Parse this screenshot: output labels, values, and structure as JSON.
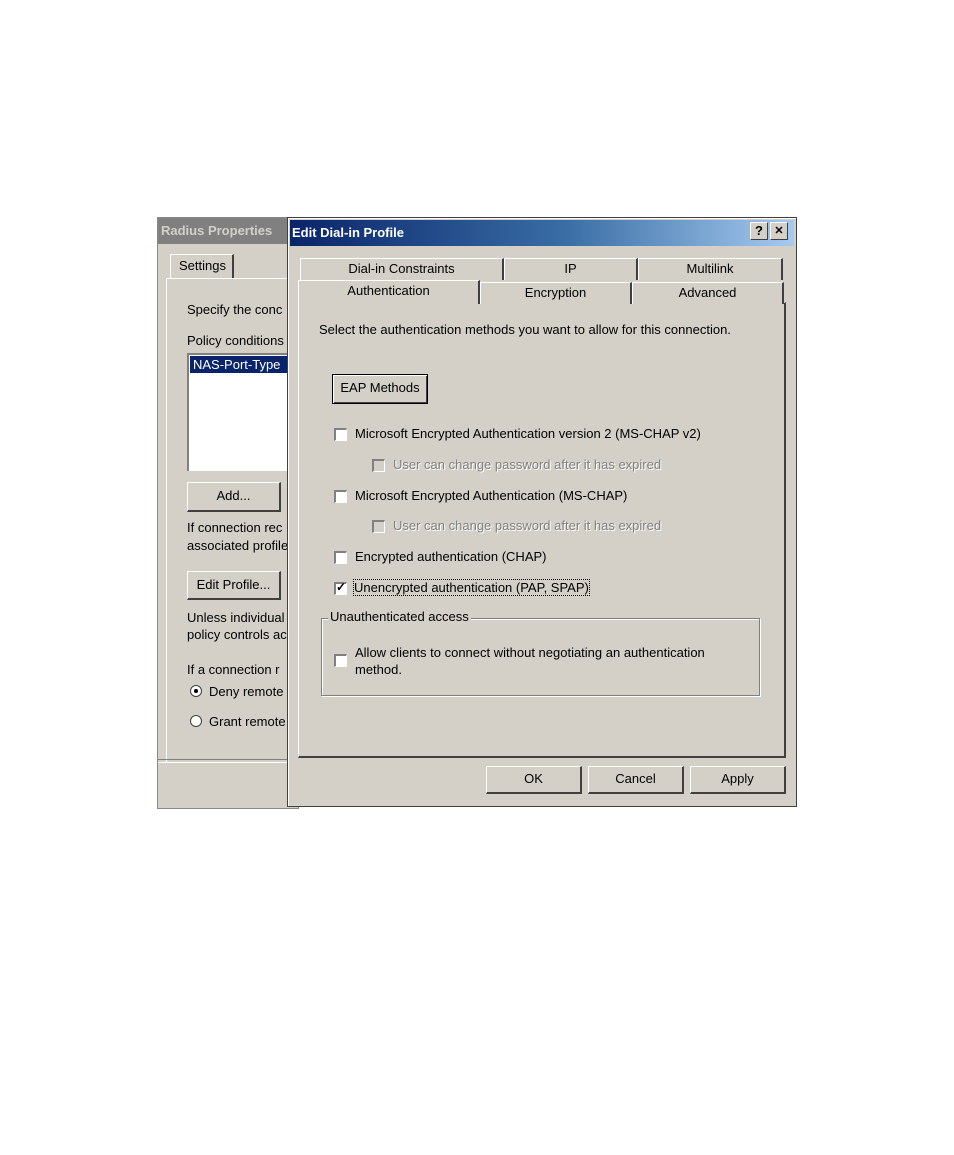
{
  "background_window": {
    "title": "Radius Properties",
    "tab_settings": "Settings",
    "specify_text": "Specify the conc",
    "policy_conditions_label": "Policy conditions",
    "policy_list_item": "NAS-Port-Type",
    "add_button": "Add...",
    "if_connection_line1": "If connection rec",
    "if_connection_line2": "associated profile",
    "edit_profile_button": "Edit Profile...",
    "unless_line1": "Unless individual",
    "unless_line2": "policy controls ac",
    "if_a_connection": "If a connection r",
    "deny_remote": "Deny remote",
    "grant_remote": "Grant remote",
    "selected_radio": "deny"
  },
  "dialog": {
    "title": "Edit Dial-in Profile",
    "help_glyph": "?",
    "close_glyph": "✕",
    "tabs_row1": [
      "Dial-in Constraints",
      "IP",
      "Multilink"
    ],
    "tabs_row2": [
      "Authentication",
      "Encryption",
      "Advanced"
    ],
    "active_tab": "Authentication",
    "instruction": "Select the authentication methods you want to allow for this connection.",
    "eap_button": "EAP Methods",
    "options": [
      {
        "label": "Microsoft Encrypted Authentication version 2 (MS-CHAP v2)",
        "checked": false,
        "enabled": true
      },
      {
        "label": "User can change password after it has expired",
        "checked": false,
        "enabled": false
      },
      {
        "label": "Microsoft Encrypted Authentication (MS-CHAP)",
        "checked": false,
        "enabled": true
      },
      {
        "label": "User can change password after it has expired",
        "checked": false,
        "enabled": false
      },
      {
        "label": "Encrypted authentication (CHAP)",
        "checked": false,
        "enabled": true
      },
      {
        "label": "Unencrypted authentication (PAP, SPAP)",
        "checked": true,
        "enabled": true
      }
    ],
    "group_title": "Unauthenticated access",
    "allow_clients_line1": "Allow clients to connect without negotiating an authentication",
    "allow_clients_line2": "method.",
    "allow_clients_checked": false,
    "ok_button": "OK",
    "cancel_button": "Cancel",
    "apply_button": "Apply"
  }
}
